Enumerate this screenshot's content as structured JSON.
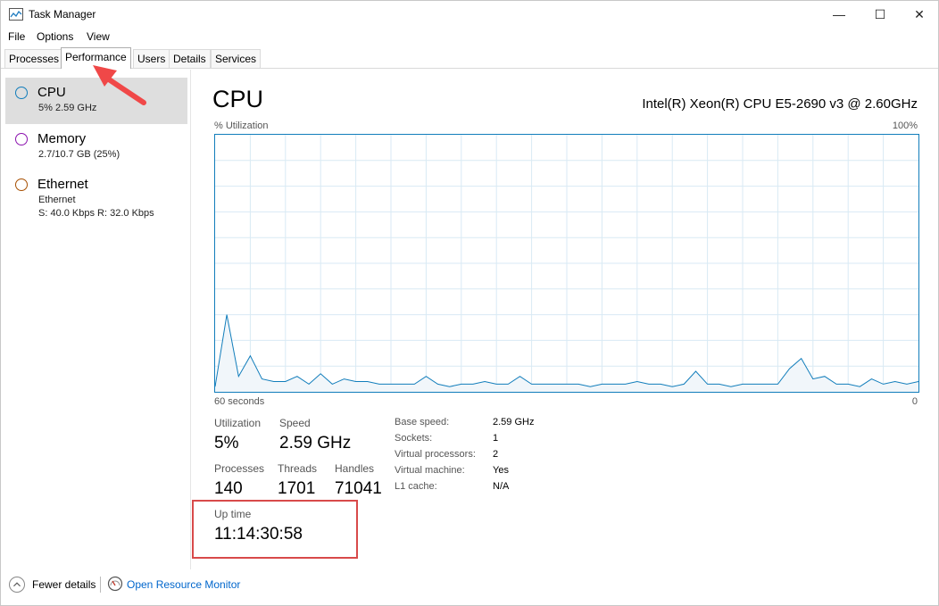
{
  "window": {
    "title": "Task Manager",
    "minimize_glyph": "—",
    "maximize_glyph": "☐",
    "close_glyph": "✕"
  },
  "menu": [
    "File",
    "Options",
    "View"
  ],
  "tabs": [
    "Processes",
    "Performance",
    "Users",
    "Details",
    "Services"
  ],
  "active_tab": "Performance",
  "sidebar": {
    "items": [
      {
        "title": "CPU",
        "line1": "5%  2.59 GHz",
        "line2": "",
        "color": "#117dbb",
        "selected": true
      },
      {
        "title": "Memory",
        "line1": "2.7/10.7 GB (25%)",
        "line2": "",
        "color": "#8b12ae",
        "selected": false
      },
      {
        "title": "Ethernet",
        "line1": "Ethernet",
        "line2": "S: 40.0 Kbps  R: 32.0 Kbps",
        "color": "#a74f01",
        "selected": false
      }
    ]
  },
  "main": {
    "title": "CPU",
    "model": "Intel(R) Xeon(R) CPU E5-2690 v3 @ 2.60GHz",
    "graph": {
      "y_label": "% Utilization",
      "y_max_label": "100%",
      "x_left_label": "60 seconds",
      "x_right_label": "0",
      "line_color": "#117dbb",
      "fill_color": "#f1f6fa",
      "grid_color": "#d9eaf4"
    },
    "stats": {
      "utilization_label": "Utilization",
      "utilization_value": "5%",
      "speed_label": "Speed",
      "speed_value": "2.59 GHz",
      "processes_label": "Processes",
      "processes_value": "140",
      "threads_label": "Threads",
      "threads_value": "1701",
      "handles_label": "Handles",
      "handles_value": "71041",
      "uptime_label": "Up time",
      "uptime_value": "11:14:30:58"
    },
    "specs": [
      {
        "label": "Base speed:",
        "value": "2.59 GHz"
      },
      {
        "label": "Sockets:",
        "value": "1"
      },
      {
        "label": "Virtual processors:",
        "value": "2"
      },
      {
        "label": "Virtual machine:",
        "value": "Yes"
      },
      {
        "label": "L1 cache:",
        "value": "N/A"
      }
    ]
  },
  "footer": {
    "fewer_details": "Fewer details",
    "open_resource_monitor": "Open Resource Monitor"
  },
  "annotation": {
    "highlight_color": "#d84a4a",
    "arrow_color": "#f04848"
  },
  "chart_data": {
    "type": "line",
    "ylim": [
      0,
      100
    ],
    "series": [
      {
        "values": [
          2,
          30,
          6,
          14,
          5,
          4,
          4,
          6,
          3,
          7,
          3,
          5,
          4,
          4,
          3,
          3,
          3,
          3,
          6,
          3,
          2,
          3,
          3,
          4,
          3,
          3,
          6,
          3,
          3,
          3,
          3,
          3,
          2,
          3,
          3,
          3,
          4,
          3,
          3,
          2,
          3,
          8,
          3,
          3,
          2,
          3,
          3,
          3,
          3,
          9,
          13,
          5,
          6,
          3,
          3,
          2,
          5,
          3,
          4,
          3,
          4
        ]
      }
    ]
  }
}
